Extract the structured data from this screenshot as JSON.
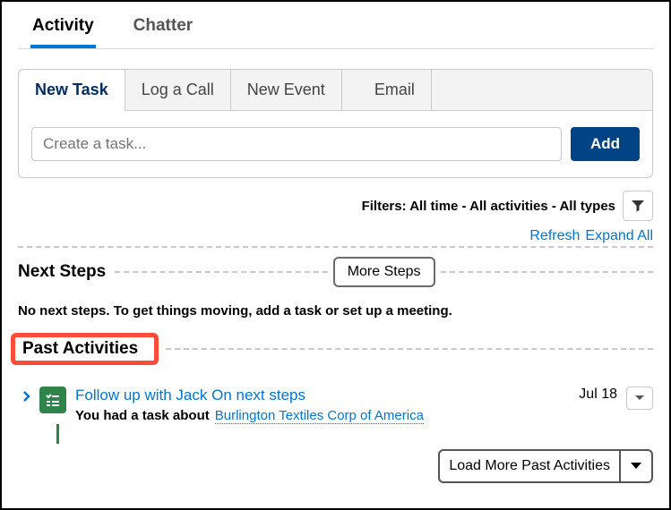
{
  "topTabs": {
    "activity": "Activity",
    "chatter": "Chatter"
  },
  "subTabs": {
    "newTask": "New Task",
    "logCall": "Log a Call",
    "newEvent": "New Event",
    "email": "Email"
  },
  "taskInput": {
    "placeholder": "Create a task..."
  },
  "addBtn": "Add",
  "filters": {
    "label": "Filters: All time - All activities - All types"
  },
  "links": {
    "refresh": "Refresh",
    "expand": "Expand All"
  },
  "nextSteps": {
    "title": "Next Steps",
    "moreBtn": "More Steps",
    "empty": "No next steps. To get things moving, add a task or set up a meeting."
  },
  "pastActivities": {
    "title": "Past Activities"
  },
  "activity": {
    "subject": "Follow up with Jack On next steps",
    "date": "Jul 18",
    "subPrefix": "You had a task about",
    "related": "Burlington Textiles Corp of America"
  },
  "loadMore": "Load More Past Activities"
}
